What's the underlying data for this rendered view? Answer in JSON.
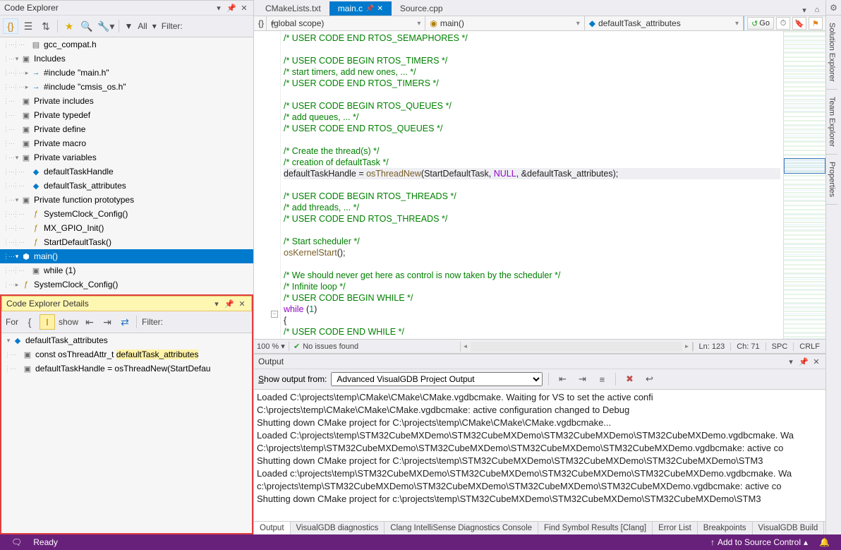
{
  "codeExplorer": {
    "title": "Code Explorer",
    "filter_label": "Filter:",
    "all_label": "All",
    "tree": [
      {
        "depth": 2,
        "icon": "file",
        "exp": "",
        "label": "gcc_compat.h"
      },
      {
        "depth": 1,
        "icon": "folder",
        "exp": "−",
        "label": "Includes"
      },
      {
        "depth": 2,
        "icon": "inc",
        "exp": "+",
        "label": "#include \"main.h\""
      },
      {
        "depth": 2,
        "icon": "inc",
        "exp": "+",
        "label": "#include \"cmsis_os.h\""
      },
      {
        "depth": 1,
        "icon": "folder",
        "exp": "",
        "label": "Private includes"
      },
      {
        "depth": 1,
        "icon": "folder",
        "exp": "",
        "label": "Private typedef"
      },
      {
        "depth": 1,
        "icon": "folder",
        "exp": "",
        "label": "Private define"
      },
      {
        "depth": 1,
        "icon": "folder",
        "exp": "",
        "label": "Private macro"
      },
      {
        "depth": 1,
        "icon": "folder",
        "exp": "−",
        "label": "Private variables"
      },
      {
        "depth": 2,
        "icon": "var",
        "exp": "",
        "label": "defaultTaskHandle"
      },
      {
        "depth": 2,
        "icon": "var",
        "exp": "",
        "label": "defaultTask_attributes"
      },
      {
        "depth": 1,
        "icon": "folder",
        "exp": "−",
        "label": "Private function prototypes"
      },
      {
        "depth": 2,
        "icon": "func",
        "exp": "",
        "label": "SystemClock_Config()"
      },
      {
        "depth": 2,
        "icon": "func",
        "exp": "",
        "label": "MX_GPIO_Init()"
      },
      {
        "depth": 2,
        "icon": "func",
        "exp": "",
        "label": "StartDefaultTask()"
      },
      {
        "depth": 1,
        "icon": "cube",
        "exp": "−",
        "label": "main()",
        "sel": true
      },
      {
        "depth": 2,
        "icon": "folder",
        "exp": "",
        "label": "while (1)"
      },
      {
        "depth": 1,
        "icon": "func",
        "exp": "+",
        "label": "SystemClock_Config()"
      }
    ]
  },
  "details": {
    "title": "Code Explorer Details",
    "for_label": "For",
    "show_label": "show",
    "filter_label": "Filter:",
    "tree": [
      {
        "depth": 0,
        "icon": "var",
        "exp": "−",
        "label": "defaultTask_attributes"
      },
      {
        "depth": 1,
        "icon": "folder",
        "exp": "",
        "html": "const osThreadAttr_t <span class='hl'>defaultTask_attributes</span>"
      },
      {
        "depth": 1,
        "icon": "folder",
        "exp": "",
        "label": "defaultTaskHandle = osThreadNew(StartDefau"
      }
    ]
  },
  "tabs": [
    {
      "label": "CMakeLists.txt",
      "active": false
    },
    {
      "label": "main.c",
      "active": true,
      "pinned": true
    },
    {
      "label": "Source.cpp",
      "active": false
    }
  ],
  "nav": {
    "scope": "(global scope)",
    "func": "main()",
    "symbol": "defaultTask_attributes",
    "go": "Go"
  },
  "code": [
    {
      "t": "c",
      "s": "/* USER CODE END RTOS_SEMAPHORES */"
    },
    {
      "t": "blank"
    },
    {
      "t": "c",
      "s": "/* USER CODE BEGIN RTOS_TIMERS */"
    },
    {
      "t": "c",
      "s": "/* start timers, add new ones, ... */"
    },
    {
      "t": "c",
      "s": "/* USER CODE END RTOS_TIMERS */"
    },
    {
      "t": "blank"
    },
    {
      "t": "c",
      "s": "/* USER CODE BEGIN RTOS_QUEUES */"
    },
    {
      "t": "c",
      "s": "/* add queues, ... */"
    },
    {
      "t": "c",
      "s": "/* USER CODE END RTOS_QUEUES */"
    },
    {
      "t": "blank"
    },
    {
      "t": "c",
      "s": "/* Create the thread(s) */"
    },
    {
      "t": "c",
      "s": "/* creation of defaultTask */"
    },
    {
      "t": "code",
      "cur": true,
      "parts": [
        {
          "t": "plain",
          "s": "defaultTaskHandle = "
        },
        {
          "t": "fn",
          "s": "osThreadNew"
        },
        {
          "t": "plain",
          "s": "(StartDefaultTask, "
        },
        {
          "t": "m",
          "s": "NULL"
        },
        {
          "t": "plain",
          "s": ", &defaultTask_attributes);"
        }
      ]
    },
    {
      "t": "blank"
    },
    {
      "t": "c",
      "s": "/* USER CODE BEGIN RTOS_THREADS */"
    },
    {
      "t": "c",
      "s": "/* add threads, ... */"
    },
    {
      "t": "c",
      "s": "/* USER CODE END RTOS_THREADS */"
    },
    {
      "t": "blank"
    },
    {
      "t": "c",
      "s": "/* Start scheduler */"
    },
    {
      "t": "code",
      "parts": [
        {
          "t": "fn",
          "s": "osKernelStart"
        },
        {
          "t": "plain",
          "s": "();"
        }
      ]
    },
    {
      "t": "blank"
    },
    {
      "t": "c",
      "s": "/* We should never get here as control is now taken by the scheduler */"
    },
    {
      "t": "c",
      "s": "/* Infinite loop */"
    },
    {
      "t": "c",
      "s": "/* USER CODE BEGIN WHILE */"
    },
    {
      "t": "code",
      "parts": [
        {
          "t": "m",
          "s": "while"
        },
        {
          "t": "plain",
          "s": " ("
        },
        {
          "t": "n",
          "s": "1"
        },
        {
          "t": "plain",
          "s": ")"
        }
      ]
    },
    {
      "t": "code",
      "parts": [
        {
          "t": "plain",
          "s": "{"
        }
      ]
    },
    {
      "t": "c",
      "s": "  /* USER CODE END WHILE */",
      "indent": 1
    }
  ],
  "editorStatus": {
    "zoom": "100 %",
    "issues": "No issues found",
    "ln": "Ln: 123",
    "ch": "Ch: 71",
    "spc": "SPC",
    "crlf": "CRLF"
  },
  "output": {
    "title": "Output",
    "show_label": "Show output from:",
    "source": "Advanced VisualGDB Project Output",
    "lines": [
      "Loaded C:\\projects\\temp\\CMake\\CMake\\CMake.vgdbcmake. Waiting for VS to set the active confi",
      "C:\\projects\\temp\\CMake\\CMake\\CMake.vgdbcmake: active configuration changed to Debug",
      "Shutting down CMake project for C:\\projects\\temp\\CMake\\CMake\\CMake.vgdbcmake...",
      "Loaded C:\\projects\\temp\\STM32CubeMXDemo\\STM32CubeMXDemo\\STM32CubeMXDemo\\STM32CubeMXDemo.vgdbcmake. Wa",
      "C:\\projects\\temp\\STM32CubeMXDemo\\STM32CubeMXDemo\\STM32CubeMXDemo\\STM32CubeMXDemo.vgdbcmake: active co",
      "Shutting down CMake project for C:\\projects\\temp\\STM32CubeMXDemo\\STM32CubeMXDemo\\STM32CubeMXDemo\\STM3",
      "Loaded c:\\projects\\temp\\STM32CubeMXDemo\\STM32CubeMXDemo\\STM32CubeMXDemo\\STM32CubeMXDemo.vgdbcmake. Wa",
      "c:\\projects\\temp\\STM32CubeMXDemo\\STM32CubeMXDemo\\STM32CubeMXDemo\\STM32CubeMXDemo.vgdbcmake: active co",
      "Shutting down CMake project for c:\\projects\\temp\\STM32CubeMXDemo\\STM32CubeMXDemo\\STM32CubeMXDemo\\STM3"
    ],
    "tabs": [
      "Output",
      "VisualGDB diagnostics",
      "Clang IntelliSense Diagnostics Console",
      "Find Symbol Results [Clang]",
      "Error List",
      "Breakpoints",
      "VisualGDB Build"
    ]
  },
  "sidebarTabs": [
    "Solution Explorer",
    "Team Explorer",
    "Properties"
  ],
  "statusbar": {
    "ready": "Ready",
    "source": "Add to Source Control"
  }
}
